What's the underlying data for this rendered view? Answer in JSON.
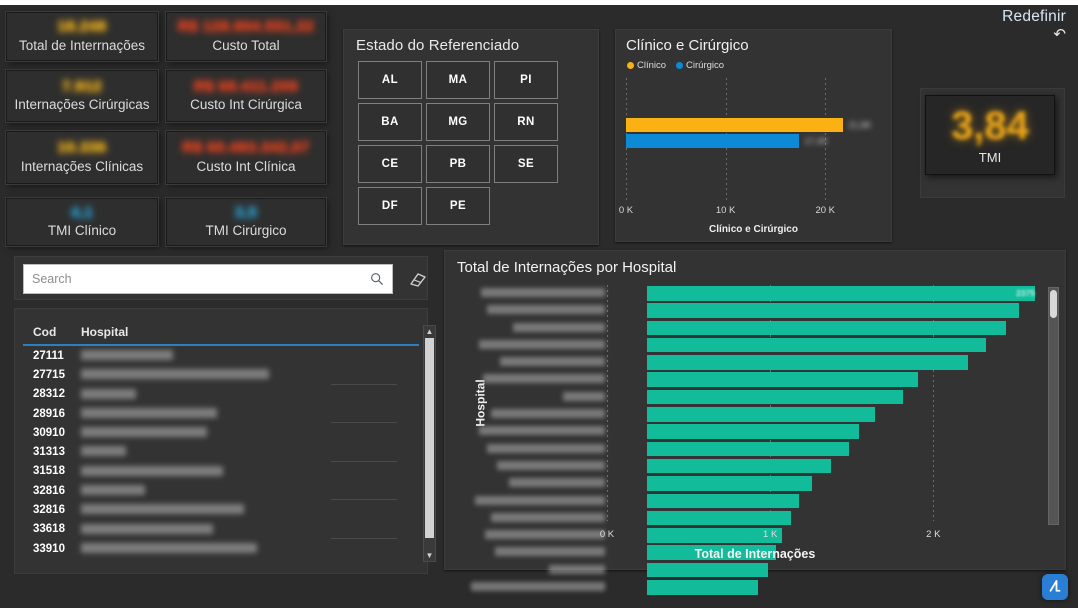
{
  "header": {
    "reset_label": "Redefinir",
    "reset_icon": "undo-arrow-icon"
  },
  "kpis": [
    {
      "label": "Total de Interrnações",
      "value": "18.248",
      "color": "#f5b51c",
      "tone": "yellow"
    },
    {
      "label": "Custo Total",
      "value": "R$ 128.904.551,32",
      "color": "#e8431f",
      "tone": "red"
    },
    {
      "label": "Internações Cirúrgicas",
      "value": "7.912",
      "color": "#f5b51c",
      "tone": "yellow"
    },
    {
      "label": "Custo Int Cirúrgica",
      "value": "R$ 68.411.209",
      "color": "#e8431f",
      "tone": "red"
    },
    {
      "label": "Internações Clínicas",
      "value": "10.336",
      "color": "#f5b51c",
      "tone": "yellow"
    },
    {
      "label": "Custo Int Clínica",
      "value": "R$ 60.493.342,07",
      "color": "#e8431f",
      "tone": "red"
    },
    {
      "label": "TMI Clínico",
      "value": "4,1",
      "color": "#2aa6d8",
      "tone": "cyan"
    },
    {
      "label": "TMI Cirúrgico",
      "value": "3,5",
      "color": "#2aa6d8",
      "tone": "cyan"
    }
  ],
  "tmi_card": {
    "value": "3,84",
    "label": "TMI",
    "color": "#e8a317"
  },
  "state_filter": {
    "title": "Estado do Referenciado",
    "items": [
      "AL",
      "MA",
      "PI",
      "BA",
      "MG",
      "RN",
      "CE",
      "PB",
      "SE",
      "DF",
      "PE"
    ]
  },
  "search": {
    "placeholder": "Search",
    "search_icon": "magnifier-icon",
    "clear_icon": "eraser-icon"
  },
  "hospital_table": {
    "columns": [
      "Cod",
      "Hospital"
    ],
    "rows": [
      {
        "cod": "27111",
        "name_width": 92
      },
      {
        "cod": "27715",
        "name_width": 188
      },
      {
        "cod": "28312",
        "name_width": 55
      },
      {
        "cod": "28916",
        "name_width": 136
      },
      {
        "cod": "30910",
        "name_width": 126
      },
      {
        "cod": "31313",
        "name_width": 45
      },
      {
        "cod": "31518",
        "name_width": 142
      },
      {
        "cod": "32816",
        "name_width": 64
      },
      {
        "cod": "32816",
        "name_width": 163
      },
      {
        "cod": "33618",
        "name_width": 132
      },
      {
        "cod": "33910",
        "name_width": 176
      }
    ]
  },
  "chart_data": [
    {
      "type": "bar",
      "orientation": "horizontal",
      "title": "Clínico e Cirúrgico",
      "xlabel": "Clínico e Cirúrgico",
      "ylabel": "",
      "categories": [
        "Clínico",
        "Cirúrgico"
      ],
      "values": [
        21800,
        17400
      ],
      "colors": [
        "#fbb013",
        "#0d8ad6"
      ],
      "legend": [
        "Clínico",
        "Cirúrgico"
      ],
      "legend_position": "top-left",
      "xlim": [
        0,
        26000
      ],
      "xticks": [
        0,
        10000,
        20000
      ],
      "xticklabels": [
        "0 K",
        "10 K",
        "20 K"
      ],
      "grid": true,
      "data_labels_blurred": true
    },
    {
      "type": "bar",
      "orientation": "horizontal",
      "title": "Total de Internações por Hospital",
      "xlabel": "Total de Internações",
      "ylabel": "Hospital",
      "categories": [
        "",
        "",
        "",
        "",
        "",
        "",
        "",
        "",
        "",
        "",
        "",
        "",
        "",
        "",
        "",
        "",
        "",
        "",
        ""
      ],
      "values": [
        2375,
        2280,
        2200,
        2080,
        1970,
        1660,
        1570,
        1400,
        1300,
        1240,
        1130,
        1010,
        930,
        880,
        830,
        790,
        740,
        680,
        610
      ],
      "series_color": "#12bb9a",
      "xlim": [
        0,
        2660
      ],
      "xticks": [
        0,
        1000,
        2000
      ],
      "xticklabels": [
        "0 K",
        "1 K",
        "2 K"
      ],
      "grid": true,
      "top_bar_label": "2375",
      "y_labels_blurred": true
    }
  ],
  "hospital_chart_rows": [
    {
      "value": 2375,
      "name_width": 124,
      "label": "2375"
    },
    {
      "value": 2280,
      "name_width": 118,
      "label": ""
    },
    {
      "value": 2200,
      "name_width": 92,
      "label": ""
    },
    {
      "value": 2080,
      "name_width": 126,
      "label": ""
    },
    {
      "value": 1970,
      "name_width": 105,
      "label": ""
    },
    {
      "value": 1660,
      "name_width": 122,
      "label": ""
    },
    {
      "value": 1570,
      "name_width": 42,
      "label": ""
    },
    {
      "value": 1400,
      "name_width": 114,
      "label": ""
    },
    {
      "value": 1300,
      "name_width": 126,
      "label": ""
    },
    {
      "value": 1240,
      "name_width": 118,
      "label": ""
    },
    {
      "value": 1130,
      "name_width": 108,
      "label": ""
    },
    {
      "value": 1010,
      "name_width": 96,
      "label": ""
    },
    {
      "value": 930,
      "name_width": 130,
      "label": ""
    },
    {
      "value": 880,
      "name_width": 114,
      "label": ""
    },
    {
      "value": 830,
      "name_width": 120,
      "label": ""
    },
    {
      "value": 790,
      "name_width": 110,
      "label": ""
    },
    {
      "value": 740,
      "name_width": 56,
      "label": ""
    },
    {
      "value": 680,
      "name_width": 134,
      "label": ""
    }
  ],
  "logo": {
    "name": "qlik-logo"
  }
}
